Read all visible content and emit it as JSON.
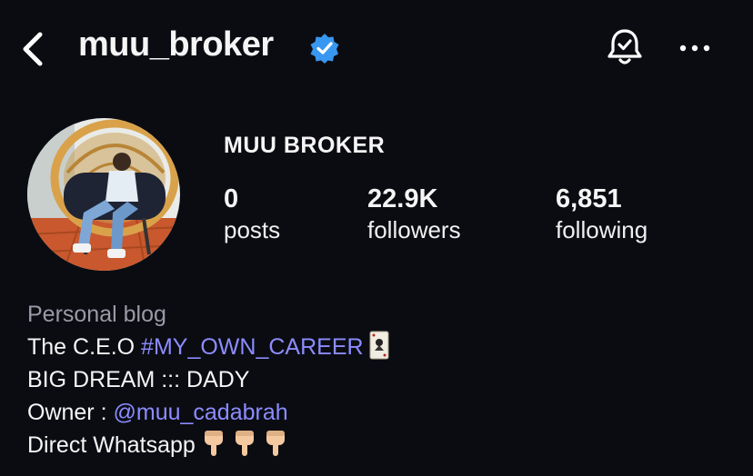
{
  "header": {
    "username": "muu_broker",
    "back_icon": "chevron-left-icon",
    "verified_icon": "verified-badge-icon",
    "notification_icon": "bell-check-icon",
    "more_icon": "more-horizontal-icon"
  },
  "profile": {
    "display_name": "MUU BROKER",
    "avatar_icon": "profile-photo"
  },
  "stats": {
    "posts": {
      "value": "0",
      "label": "posts"
    },
    "followers": {
      "value": "22.9K",
      "label": "followers"
    },
    "following": {
      "value": "6,851",
      "label": "following"
    }
  },
  "bio": {
    "category": "Personal blog",
    "line1_prefix": "The C.E.O ",
    "line1_hashtag": "#MY_OWN_CAREER",
    "line2": "BIG DREAM ::: DADY",
    "line3_prefix": "Owner : ",
    "line3_mention": "@muu_cadabrah",
    "line4": "Direct Whatsapp"
  },
  "colors": {
    "background": "#0b0c12",
    "link": "#8c8cff",
    "verified": "#3897f0",
    "muted": "#9a9aa6"
  }
}
